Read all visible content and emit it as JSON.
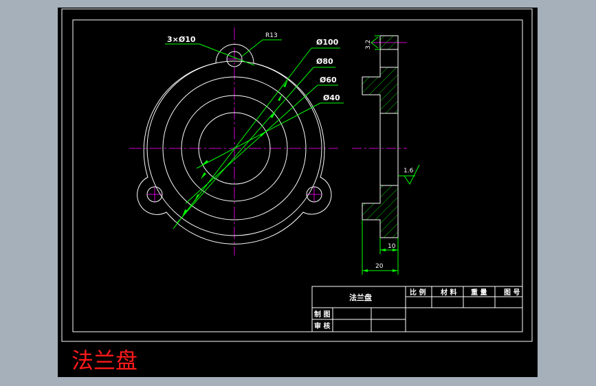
{
  "colors": {
    "background": "#a6b0bb",
    "sheet": "#000000",
    "border": "#ffffff",
    "centerline": "#d000d0",
    "dimension": "#00ff00",
    "geometry": "#ffffff",
    "hatch": "#00cc00",
    "title_red": "#ff1a1a"
  },
  "drawing": {
    "dims": {
      "holes": "3×Ø10",
      "radius": "R13",
      "d100": "Ø100",
      "d80": "Ø80",
      "d60": "Ø60",
      "d40": "Ø40",
      "thickness_total": "20",
      "thickness_step": "10",
      "roughness_top": "3.2",
      "roughness_face": "1.6"
    }
  },
  "title_block": {
    "part_name": "法兰盘",
    "scale_label": "比 例",
    "material_label": "材 料",
    "weight_label": "重 量",
    "drawing_no_label": "图 号",
    "drawn_label": "制 图",
    "checked_label": "审 核"
  },
  "caption": "法兰盘"
}
